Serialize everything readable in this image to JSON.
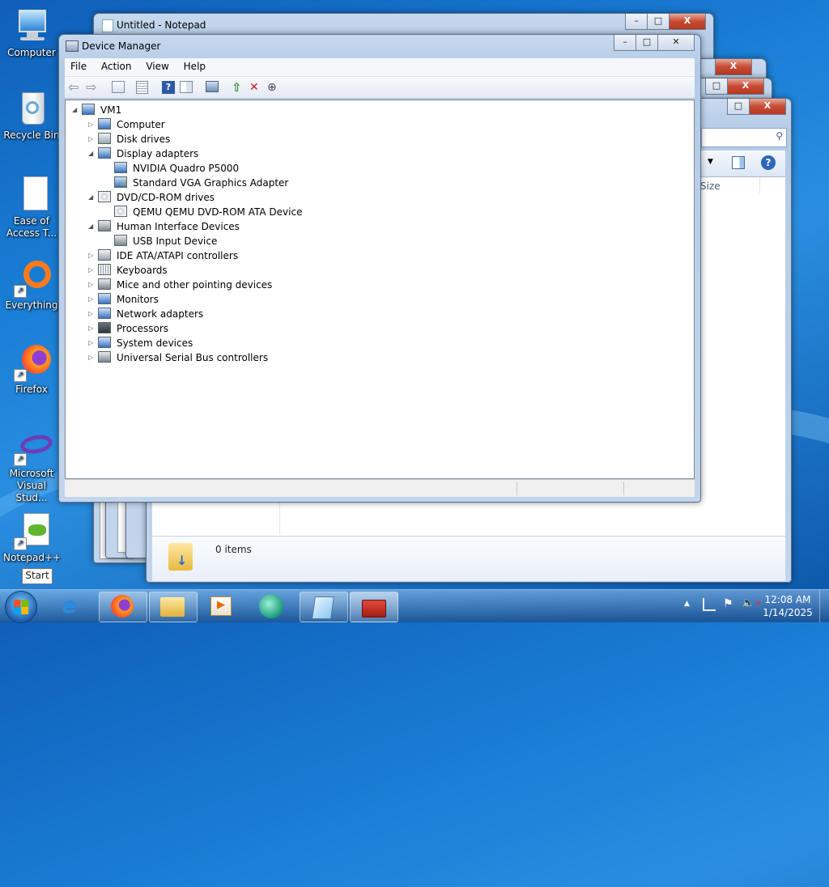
{
  "desktop": {
    "icons": [
      {
        "label": "Computer"
      },
      {
        "label": "Recycle Bin"
      },
      {
        "label": "Ease of Access T..."
      },
      {
        "label": "Everything"
      },
      {
        "label": "Firefox"
      },
      {
        "label": "Microsoft Visual Stud..."
      },
      {
        "label": "Notepad++"
      }
    ],
    "start_tooltip": "Start"
  },
  "notepad": {
    "title": "Untitled - Notepad",
    "min": "–",
    "max": "□",
    "close": "X"
  },
  "explorer": {
    "items_text": "0 items",
    "size_header": "Size"
  },
  "device_manager": {
    "title": "Device Manager",
    "menu": [
      "File",
      "Action",
      "View",
      "Help"
    ],
    "tree": [
      {
        "label": "VM1",
        "level": 0,
        "expand": "◢"
      },
      {
        "label": "Computer",
        "level": 1,
        "expand": "▷"
      },
      {
        "label": "Disk drives",
        "level": 1,
        "expand": "▷"
      },
      {
        "label": "Display adapters",
        "level": 1,
        "expand": "◢"
      },
      {
        "label": "NVIDIA Quadro P5000",
        "level": 2,
        "expand": ""
      },
      {
        "label": "Standard VGA Graphics Adapter",
        "level": 2,
        "expand": ""
      },
      {
        "label": "DVD/CD-ROM drives",
        "level": 1,
        "expand": "◢"
      },
      {
        "label": "QEMU QEMU DVD-ROM ATA Device",
        "level": 2,
        "expand": ""
      },
      {
        "label": "Human Interface Devices",
        "level": 1,
        "expand": "◢"
      },
      {
        "label": "USB Input Device",
        "level": 2,
        "expand": ""
      },
      {
        "label": "IDE ATA/ATAPI controllers",
        "level": 1,
        "expand": "▷"
      },
      {
        "label": "Keyboards",
        "level": 1,
        "expand": "▷"
      },
      {
        "label": "Mice and other pointing devices",
        "level": 1,
        "expand": "▷"
      },
      {
        "label": "Monitors",
        "level": 1,
        "expand": "▷"
      },
      {
        "label": "Network adapters",
        "level": 1,
        "expand": "▷"
      },
      {
        "label": "Processors",
        "level": 1,
        "expand": "▷"
      },
      {
        "label": "System devices",
        "level": 1,
        "expand": "▷"
      },
      {
        "label": "Universal Serial Bus controllers",
        "level": 1,
        "expand": "▷"
      }
    ]
  },
  "tray": {
    "time": "12:08 AM",
    "date": "1/14/2025"
  },
  "colors": {
    "accent": "#1a7fd6",
    "window_frame": "#b4cbe6",
    "taskbar": "#2a5f9a"
  }
}
